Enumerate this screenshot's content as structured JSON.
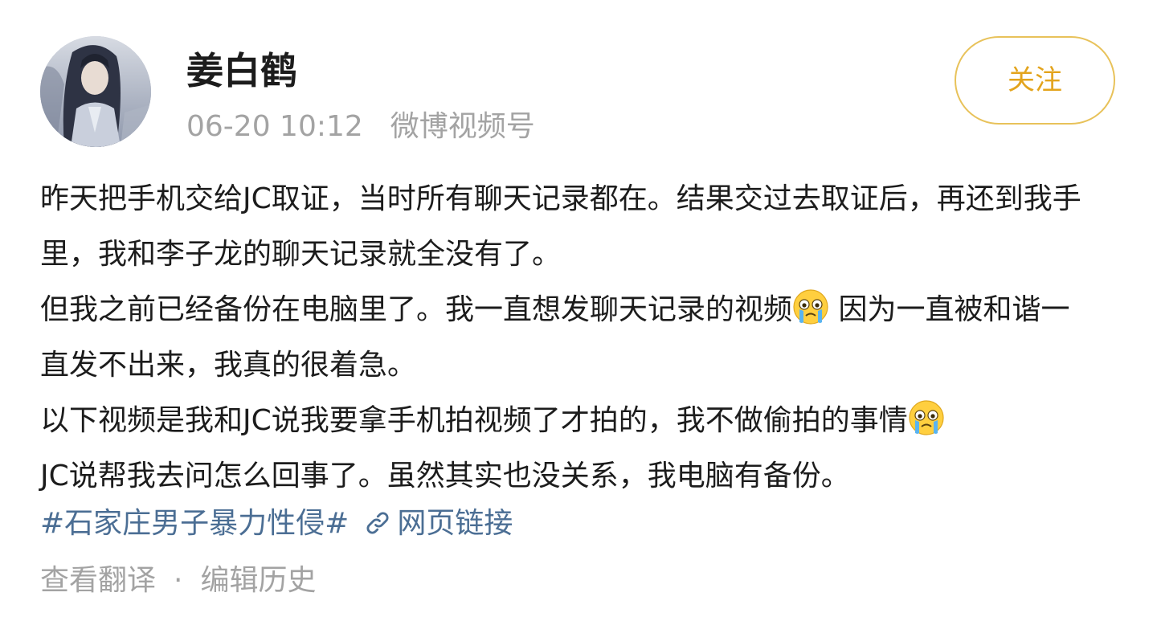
{
  "header": {
    "avatar_icon": "user-avatar-illustration",
    "username": "姜白鹤",
    "timestamp": "06-20 10:12",
    "source": "微博视频号",
    "follow_label": "关注"
  },
  "body": {
    "lines": {
      "l1": "昨天把手机交给JC取证，当时所有聊天记录都在。结果交过去取证后，再还到我手",
      "l2": "里，我和李子龙的聊天记录就全没有了。",
      "l3a": "但我之前已经备份在电脑里了。我一直想发聊天记录的视频",
      "l3b": " 因为一直被和谐一",
      "l4": "直发不出来，我真的很着急。",
      "l5": "以下视频是我和JC说我要拿手机拍视频了才拍的，我不做偷拍的事情",
      "l6": "JC说帮我去问怎么回事了。虽然其实也没关系，我电脑有备份。"
    },
    "emoji_icon": "crying-face-emoji"
  },
  "tags": {
    "hashtag": "#石家庄男子暴力性侵#",
    "link_icon": "link-icon",
    "link_label": "网页链接"
  },
  "footer": {
    "translate": "查看翻译",
    "separator": "·",
    "edit_history": "编辑历史"
  },
  "colors": {
    "accent": "#e3a41d",
    "link": "#4b6e94",
    "muted": "#a3a3a3",
    "text": "#1c1c1c"
  }
}
